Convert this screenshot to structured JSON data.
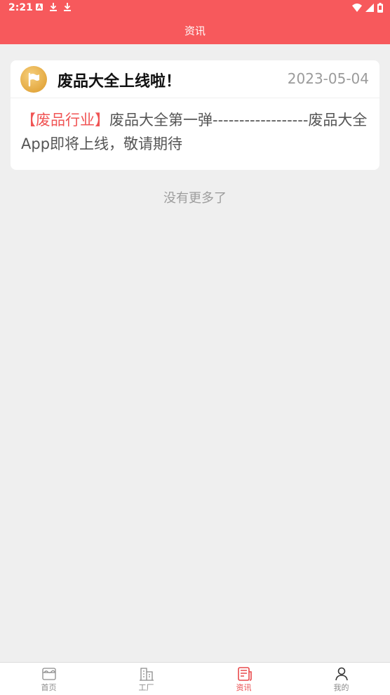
{
  "status_bar": {
    "time": "2:21",
    "icons": [
      "notification-a-icon",
      "download-icon",
      "download-icon",
      "wifi-icon",
      "signal-icon",
      "battery-icon"
    ]
  },
  "header": {
    "title": "资讯"
  },
  "colors": {
    "brand": "#f7595c",
    "tag": "#f05454",
    "active_tab": "#e9494b"
  },
  "news": [
    {
      "icon": "flag-icon",
      "title": "废品大全上线啦！",
      "date": "2023-05-04",
      "tag": "【废品行业】",
      "summary": "废品大全第一弹------------------废品大全App即将上线，敬请期待"
    }
  ],
  "list_footer": "没有更多了",
  "tabs": [
    {
      "label": "首页",
      "icon": "home-icon",
      "active": false
    },
    {
      "label": "工厂",
      "icon": "factory-icon",
      "active": false
    },
    {
      "label": "资讯",
      "icon": "news-icon",
      "active": true
    },
    {
      "label": "我的",
      "icon": "profile-icon",
      "active": false
    }
  ]
}
